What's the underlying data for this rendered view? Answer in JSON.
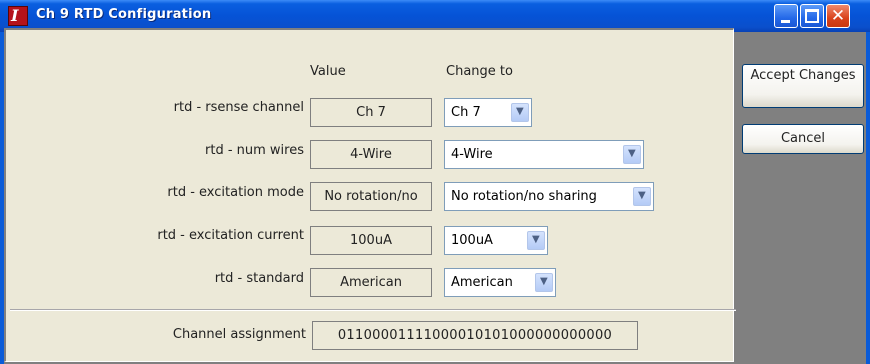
{
  "window": {
    "title": "Ch 9 RTD Configuration",
    "icon": "app-logo-icon",
    "icon_glyph": "I",
    "controls": [
      "minimize-icon",
      "maximize-icon",
      "close-icon"
    ]
  },
  "headers": {
    "value": "Value",
    "change_to": "Change to"
  },
  "rows": [
    {
      "label": "rtd - rsense channel",
      "value": "Ch 7",
      "selected": "Ch 7"
    },
    {
      "label": "rtd - num wires",
      "value": "4-Wire",
      "selected": "4-Wire"
    },
    {
      "label": "rtd - excitation mode",
      "value": "No rotation/no",
      "selected": "No rotation/no sharing"
    },
    {
      "label": "rtd - excitation current",
      "value": "100uA",
      "selected": "100uA"
    },
    {
      "label": "rtd - standard",
      "value": "American",
      "selected": "American"
    }
  ],
  "assignment": {
    "label": "Channel assignment",
    "value": "01100001111000010101000000000000"
  },
  "buttons": {
    "accept": "Accept Changes",
    "cancel": "Cancel"
  },
  "colors": {
    "titlebar": "#0653d6",
    "close": "#d9431c",
    "panel": "#ece9d8",
    "frame": "#808080"
  }
}
